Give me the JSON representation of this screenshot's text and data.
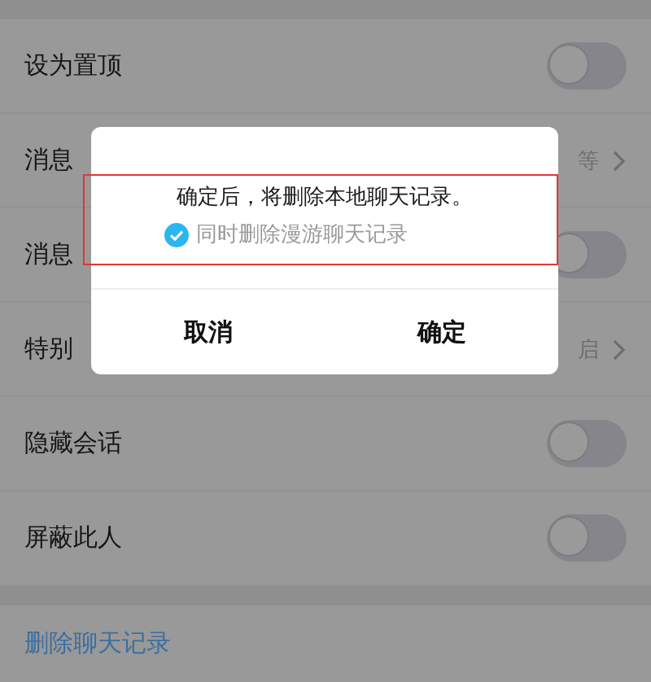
{
  "rows": [
    {
      "kind": "toggle",
      "label": "设为置顶",
      "on": false
    },
    {
      "kind": "link",
      "label": "消息",
      "value": "等"
    },
    {
      "kind": "toggle",
      "label": "消息",
      "on": false
    },
    {
      "kind": "link",
      "label": "特别",
      "value": "启"
    },
    {
      "kind": "toggle",
      "label": "隐藏会话",
      "on": false
    },
    {
      "kind": "toggle",
      "label": "屏蔽此人",
      "on": false
    }
  ],
  "delete_link": "删除聊天记录",
  "dialog": {
    "message": "确定后，将删除本地聊天记录。",
    "option": {
      "label": "同时删除漫游聊天记录",
      "checked": true
    },
    "buttons": [
      "取消",
      "确定"
    ]
  }
}
